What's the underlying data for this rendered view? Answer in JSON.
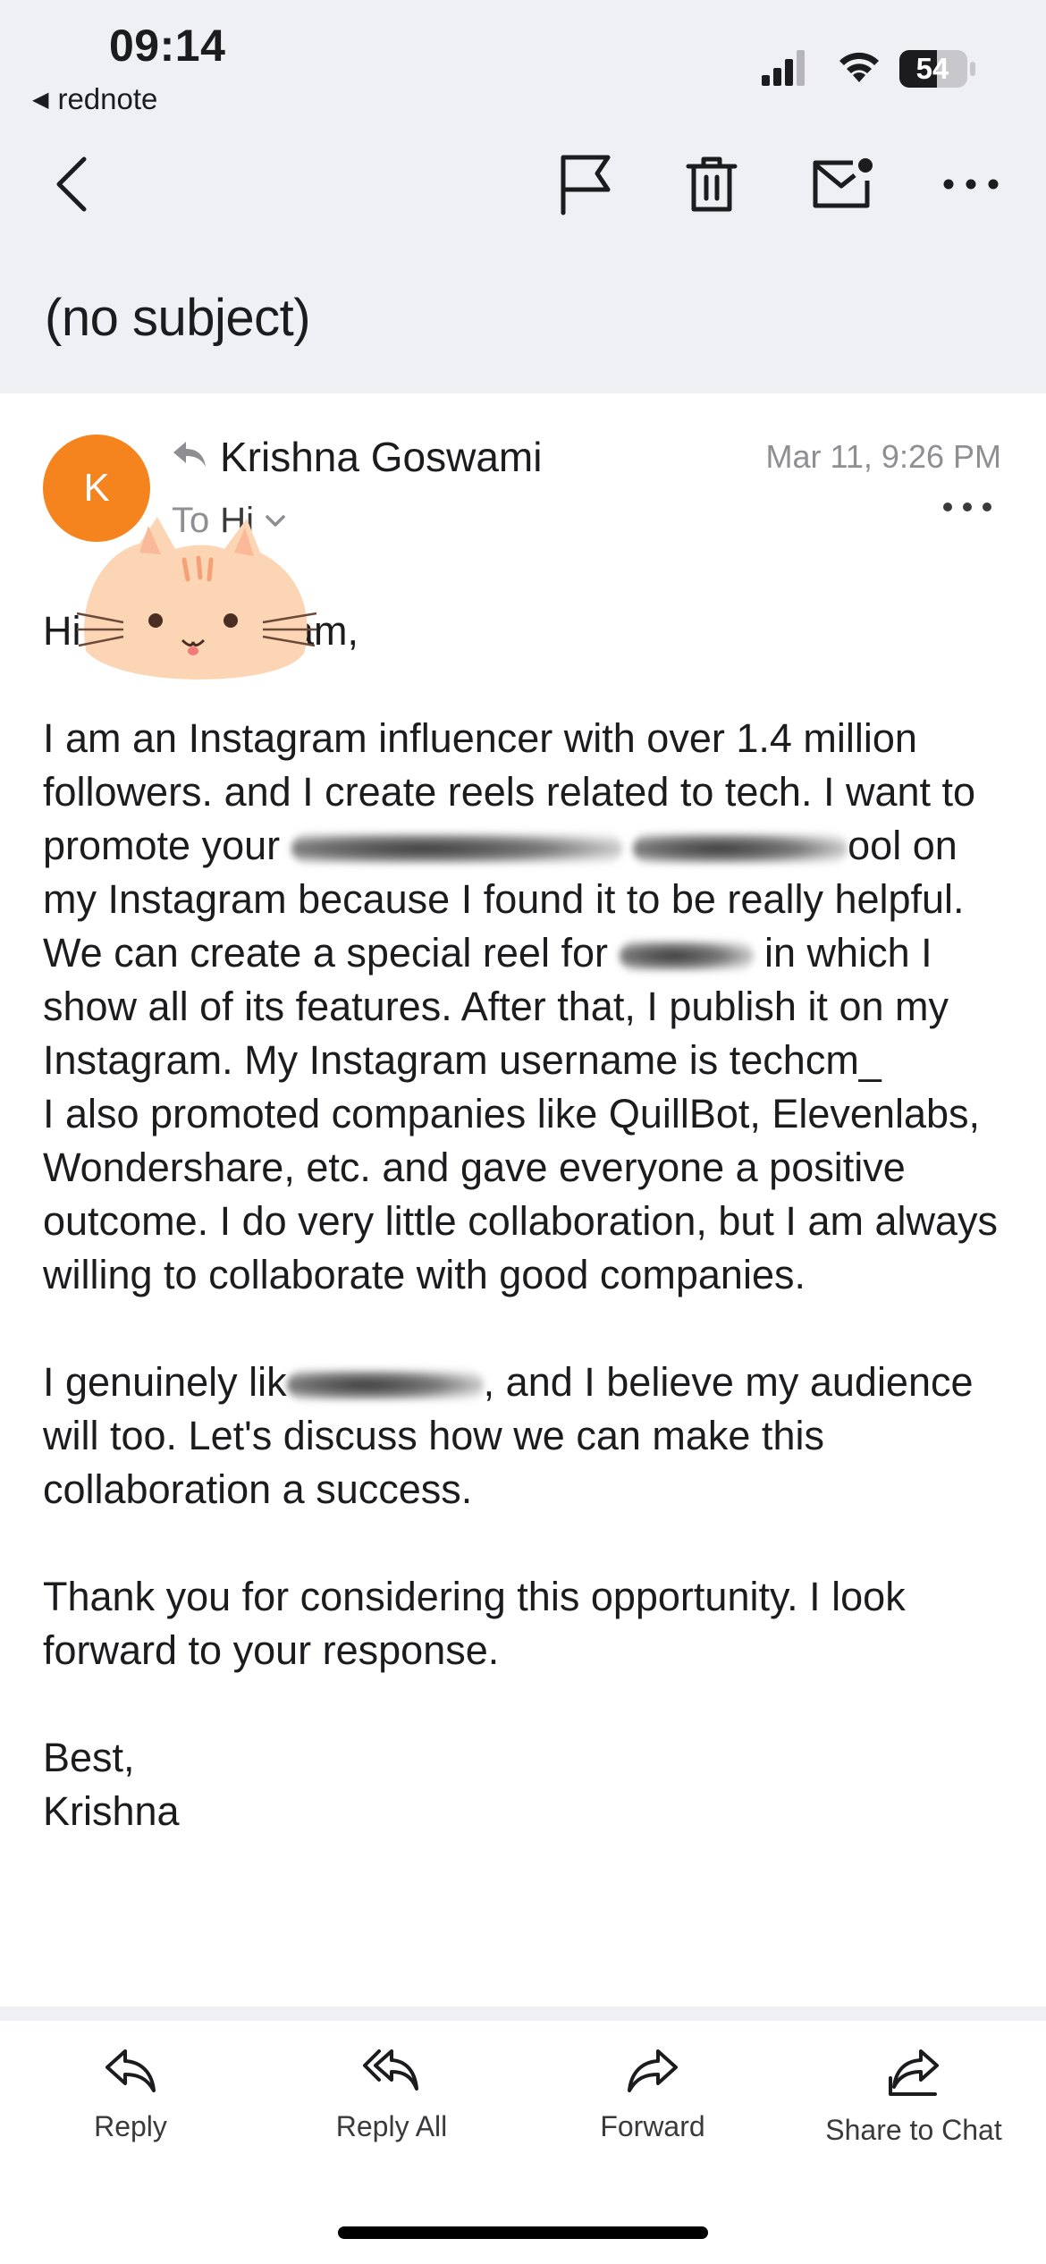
{
  "status_bar": {
    "time": "09:14",
    "back_app": "rednote",
    "battery": "54"
  },
  "toolbar": {
    "back_icon": "chevron-left-icon",
    "flag_icon": "flag-icon",
    "trash_icon": "trash-icon",
    "mail_icon": "mail-unread-icon",
    "more_icon": "more-horizontal-icon"
  },
  "email": {
    "subject": "(no subject)",
    "avatar_letter": "K",
    "avatar_color": "#f5841f",
    "sender": "Krishna Goswami",
    "date": "Mar 11, 9:26 PM",
    "to_label": "To",
    "to_name": "Hi",
    "body": {
      "greeting_a": "Hi",
      "greeting_b": "Team,",
      "p1_a": "I am an Instagram influencer with over 1.4 million followers. and I create reels related to tech. I want to promote your",
      "p1_b": "ool on my Instagram because I found it to be really helpful. We can create a special reel for",
      "p1_c": "in which I show all of its features. After that, I publish it on my Instagram. My Instagram username is techcm_",
      "p2": "I also promoted companies like QuillBot, Elevenlabs, Wondershare, etc. and gave everyone a positive outcome. I do very little collaboration, but I am always willing to collaborate with good companies.",
      "p3_a": "I genuinely lik",
      "p3_b": ", and I believe my audience will too. Let's discuss how we can make this collaboration a success.",
      "p4": "Thank you for considering this opportunity. I look forward to your response.",
      "sign_1": "Best,",
      "sign_2": "Krishna"
    }
  },
  "actions": {
    "reply": "Reply",
    "reply_all": "Reply All",
    "forward": "Forward",
    "share": "Share to Chat"
  }
}
